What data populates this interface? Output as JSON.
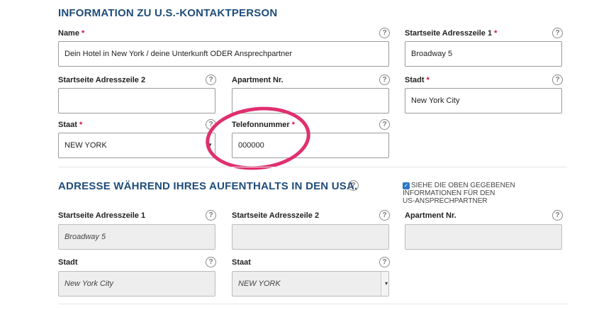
{
  "section1": {
    "title": "INFORMATION ZU U.S.-KONTAKTPERSON",
    "fields": {
      "name": {
        "label": "Name",
        "value": "Dein Hotel in New York / deine Unterkunft ODER Ansprechpartner"
      },
      "address1": {
        "label": "Startseite Adresszeile 1",
        "value": "Broadway 5"
      },
      "address2": {
        "label": "Startseite Adresszeile 2",
        "value": ""
      },
      "apartment": {
        "label": "Apartment Nr.",
        "value": ""
      },
      "city": {
        "label": "Stadt",
        "value": "New York City"
      },
      "state": {
        "label": "Staat",
        "value": "NEW YORK"
      },
      "phone": {
        "label": "Telefonnummer",
        "value": "000000"
      }
    }
  },
  "section2": {
    "title": "ADRESSE WÄHREND IHRES AUFENTHALTS IN DEN USA.",
    "checkbox_label": [
      "SIEHE DIE OBEN GEGEBENEN",
      "INFORMATIONEN FÜR DEN",
      "US-ANSPRECHPARTNER"
    ],
    "checkbox_checked": true,
    "fields": {
      "address1": {
        "label": "Startseite Adresszeile 1",
        "value": "Broadway 5"
      },
      "address2": {
        "label": "Startseite Adresszeile 2",
        "value": ""
      },
      "apartment": {
        "label": "Apartment Nr.",
        "value": ""
      },
      "city": {
        "label": "Stadt",
        "value": "New York City"
      },
      "state": {
        "label": "Staat",
        "value": "NEW YORK"
      }
    }
  },
  "ui": {
    "required_mark": "*",
    "help_glyph": "?",
    "annotation_color": "#e0306e",
    "title_color": "#1f4d7a"
  }
}
